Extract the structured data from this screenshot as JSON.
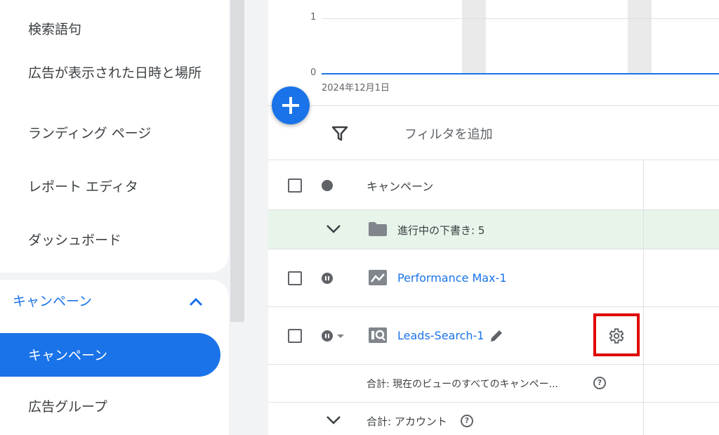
{
  "sidebar": {
    "items_top": [
      "検索語句",
      "広告が表示された日時と場所",
      "ランディング ページ",
      "レポート エディタ",
      "ダッシュボード"
    ],
    "section": {
      "label": "キャンペーン",
      "icon": "chevron-up-icon"
    },
    "active_item": "キャンペーン",
    "items_bottom": [
      "広告グループ"
    ]
  },
  "chart": {
    "y_ticks": [
      "1",
      "0"
    ],
    "x_start_label": "2024年12月1日"
  },
  "fab": {
    "icon": "plus-icon"
  },
  "filter": {
    "icon": "filter-icon",
    "placeholder": "フィルタを追加"
  },
  "table": {
    "header": {
      "label": "キャンペーン"
    },
    "group_row": {
      "label": "進行中の下書き: 5",
      "icon": "folder-icon"
    },
    "rows": [
      {
        "name": "Performance Max-1",
        "status": "paused",
        "type_icon": "performance-max-icon"
      },
      {
        "name": "Leads-Search-1",
        "status": "paused",
        "type_icon": "search-campaign-icon",
        "edit_icon": "pencil-icon",
        "settings_icon": "gear-icon"
      }
    ],
    "total_view": "合計: 現在のビューのすべてのキャンペー...",
    "total_account": "合計: アカウント",
    "help_symbol": "?"
  },
  "colors": {
    "accent": "#1a73e8",
    "highlight": "#e00000",
    "group_bg": "#e6f4ea"
  }
}
